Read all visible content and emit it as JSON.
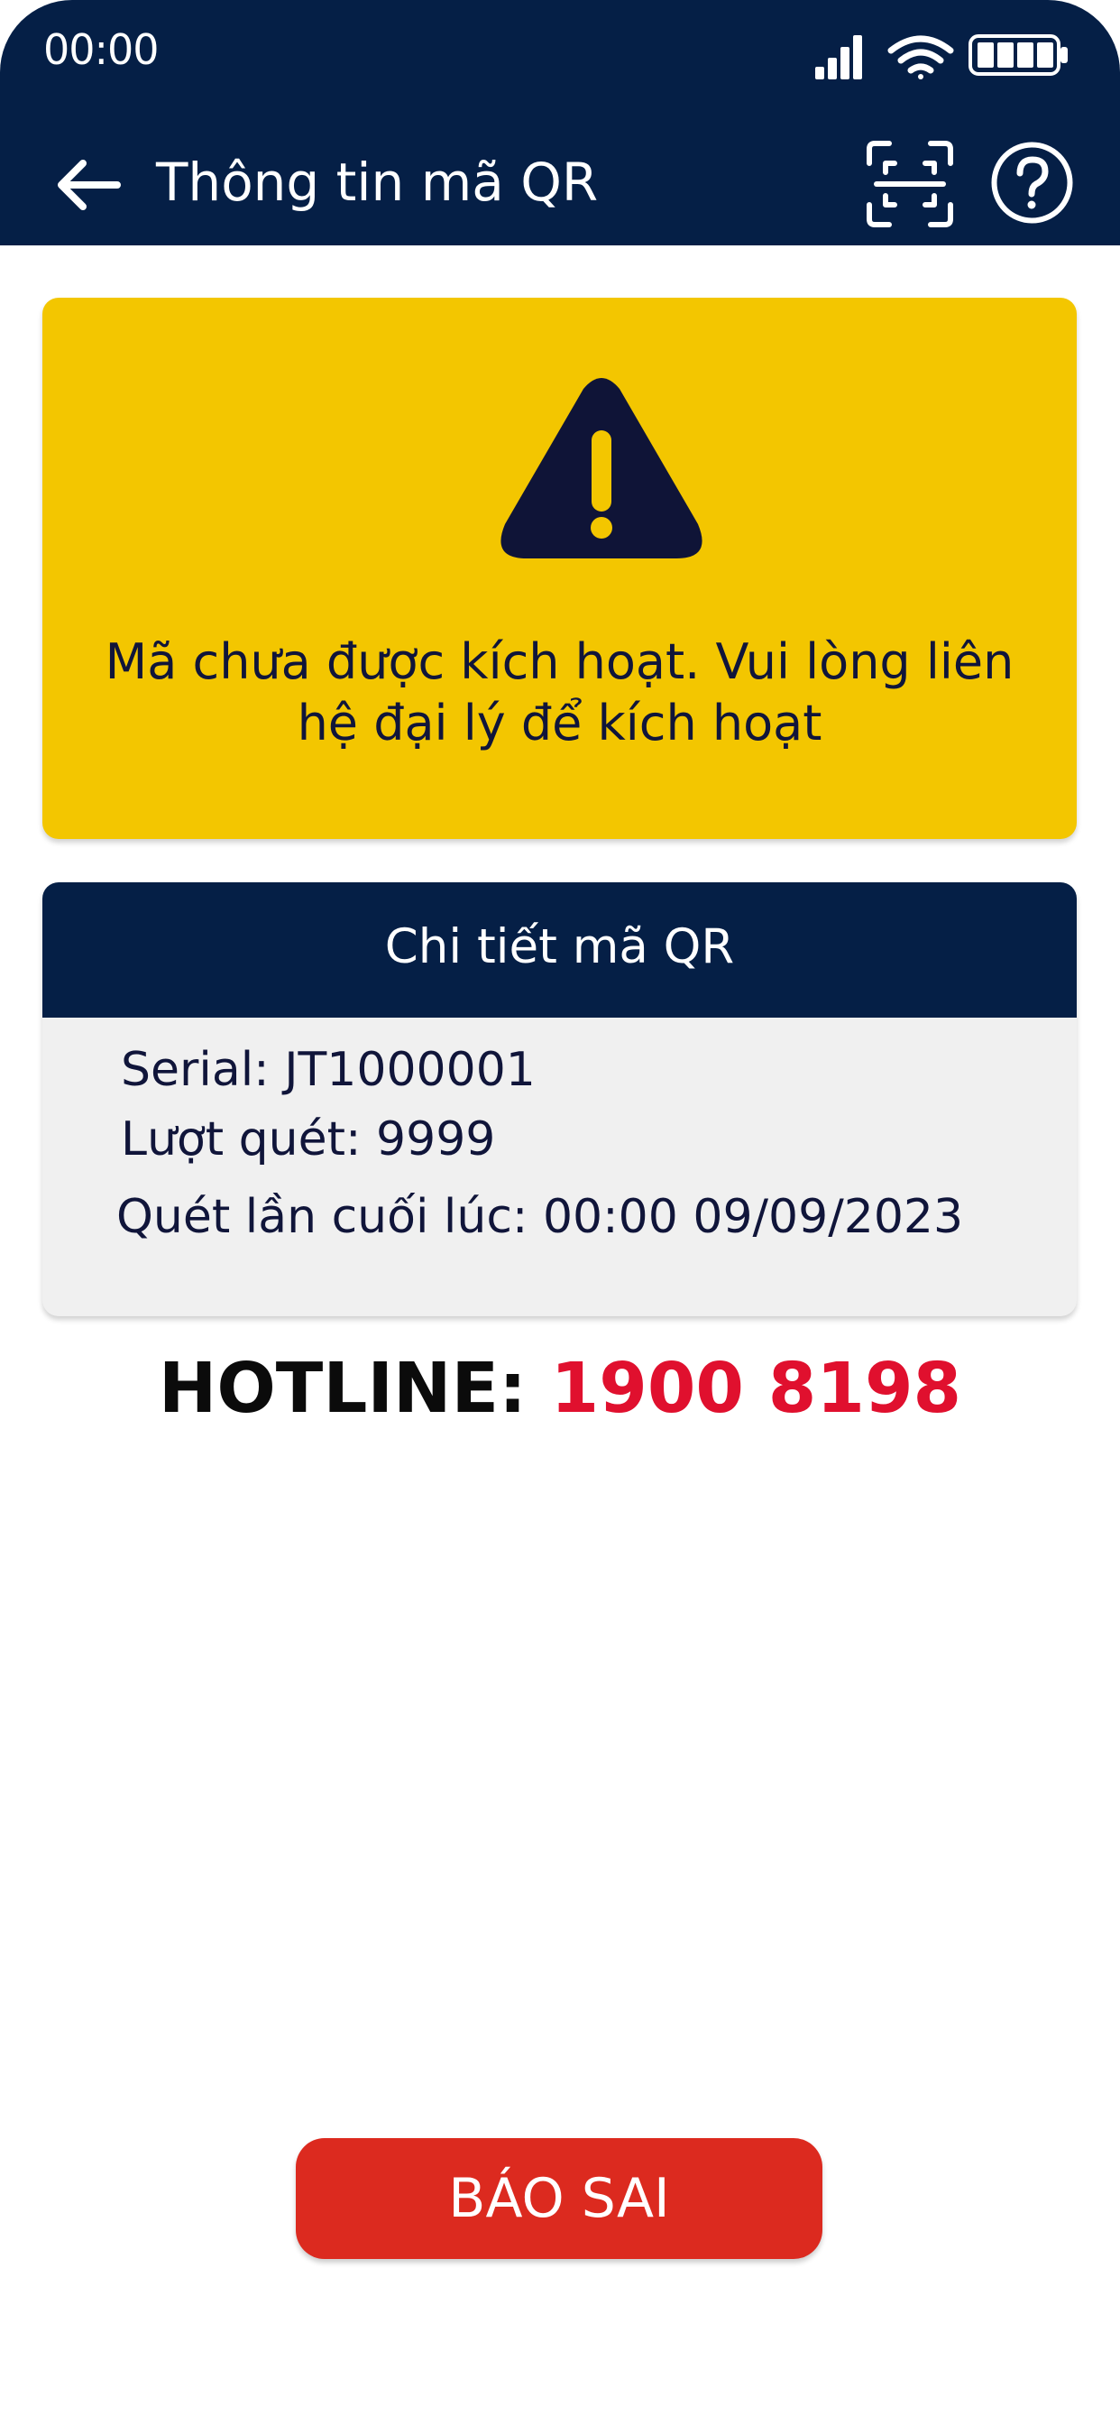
{
  "status_bar": {
    "time": "00:00"
  },
  "header": {
    "title": "Thông tin mã QR"
  },
  "warning": {
    "message": "Mã chưa được kích hoạt. Vui lòng liên hệ đại lý để kích hoạt"
  },
  "details": {
    "title": "Chi tiết mã QR",
    "serial": "Serial: JT1000001",
    "scan_count": "Lượt quét: 9999",
    "last_scanned": "Quét lần cuối lúc: 00:00 09/09/2023"
  },
  "hotline": {
    "label": "HOTLINE: ",
    "number": "1900 8198"
  },
  "actions": {
    "report_label": "BÁO SAI"
  },
  "colors": {
    "header_bg": "#051f46",
    "warning_bg": "#f3c600",
    "hotline_number": "#e0102e",
    "report_button_bg": "#dc2a1f"
  }
}
